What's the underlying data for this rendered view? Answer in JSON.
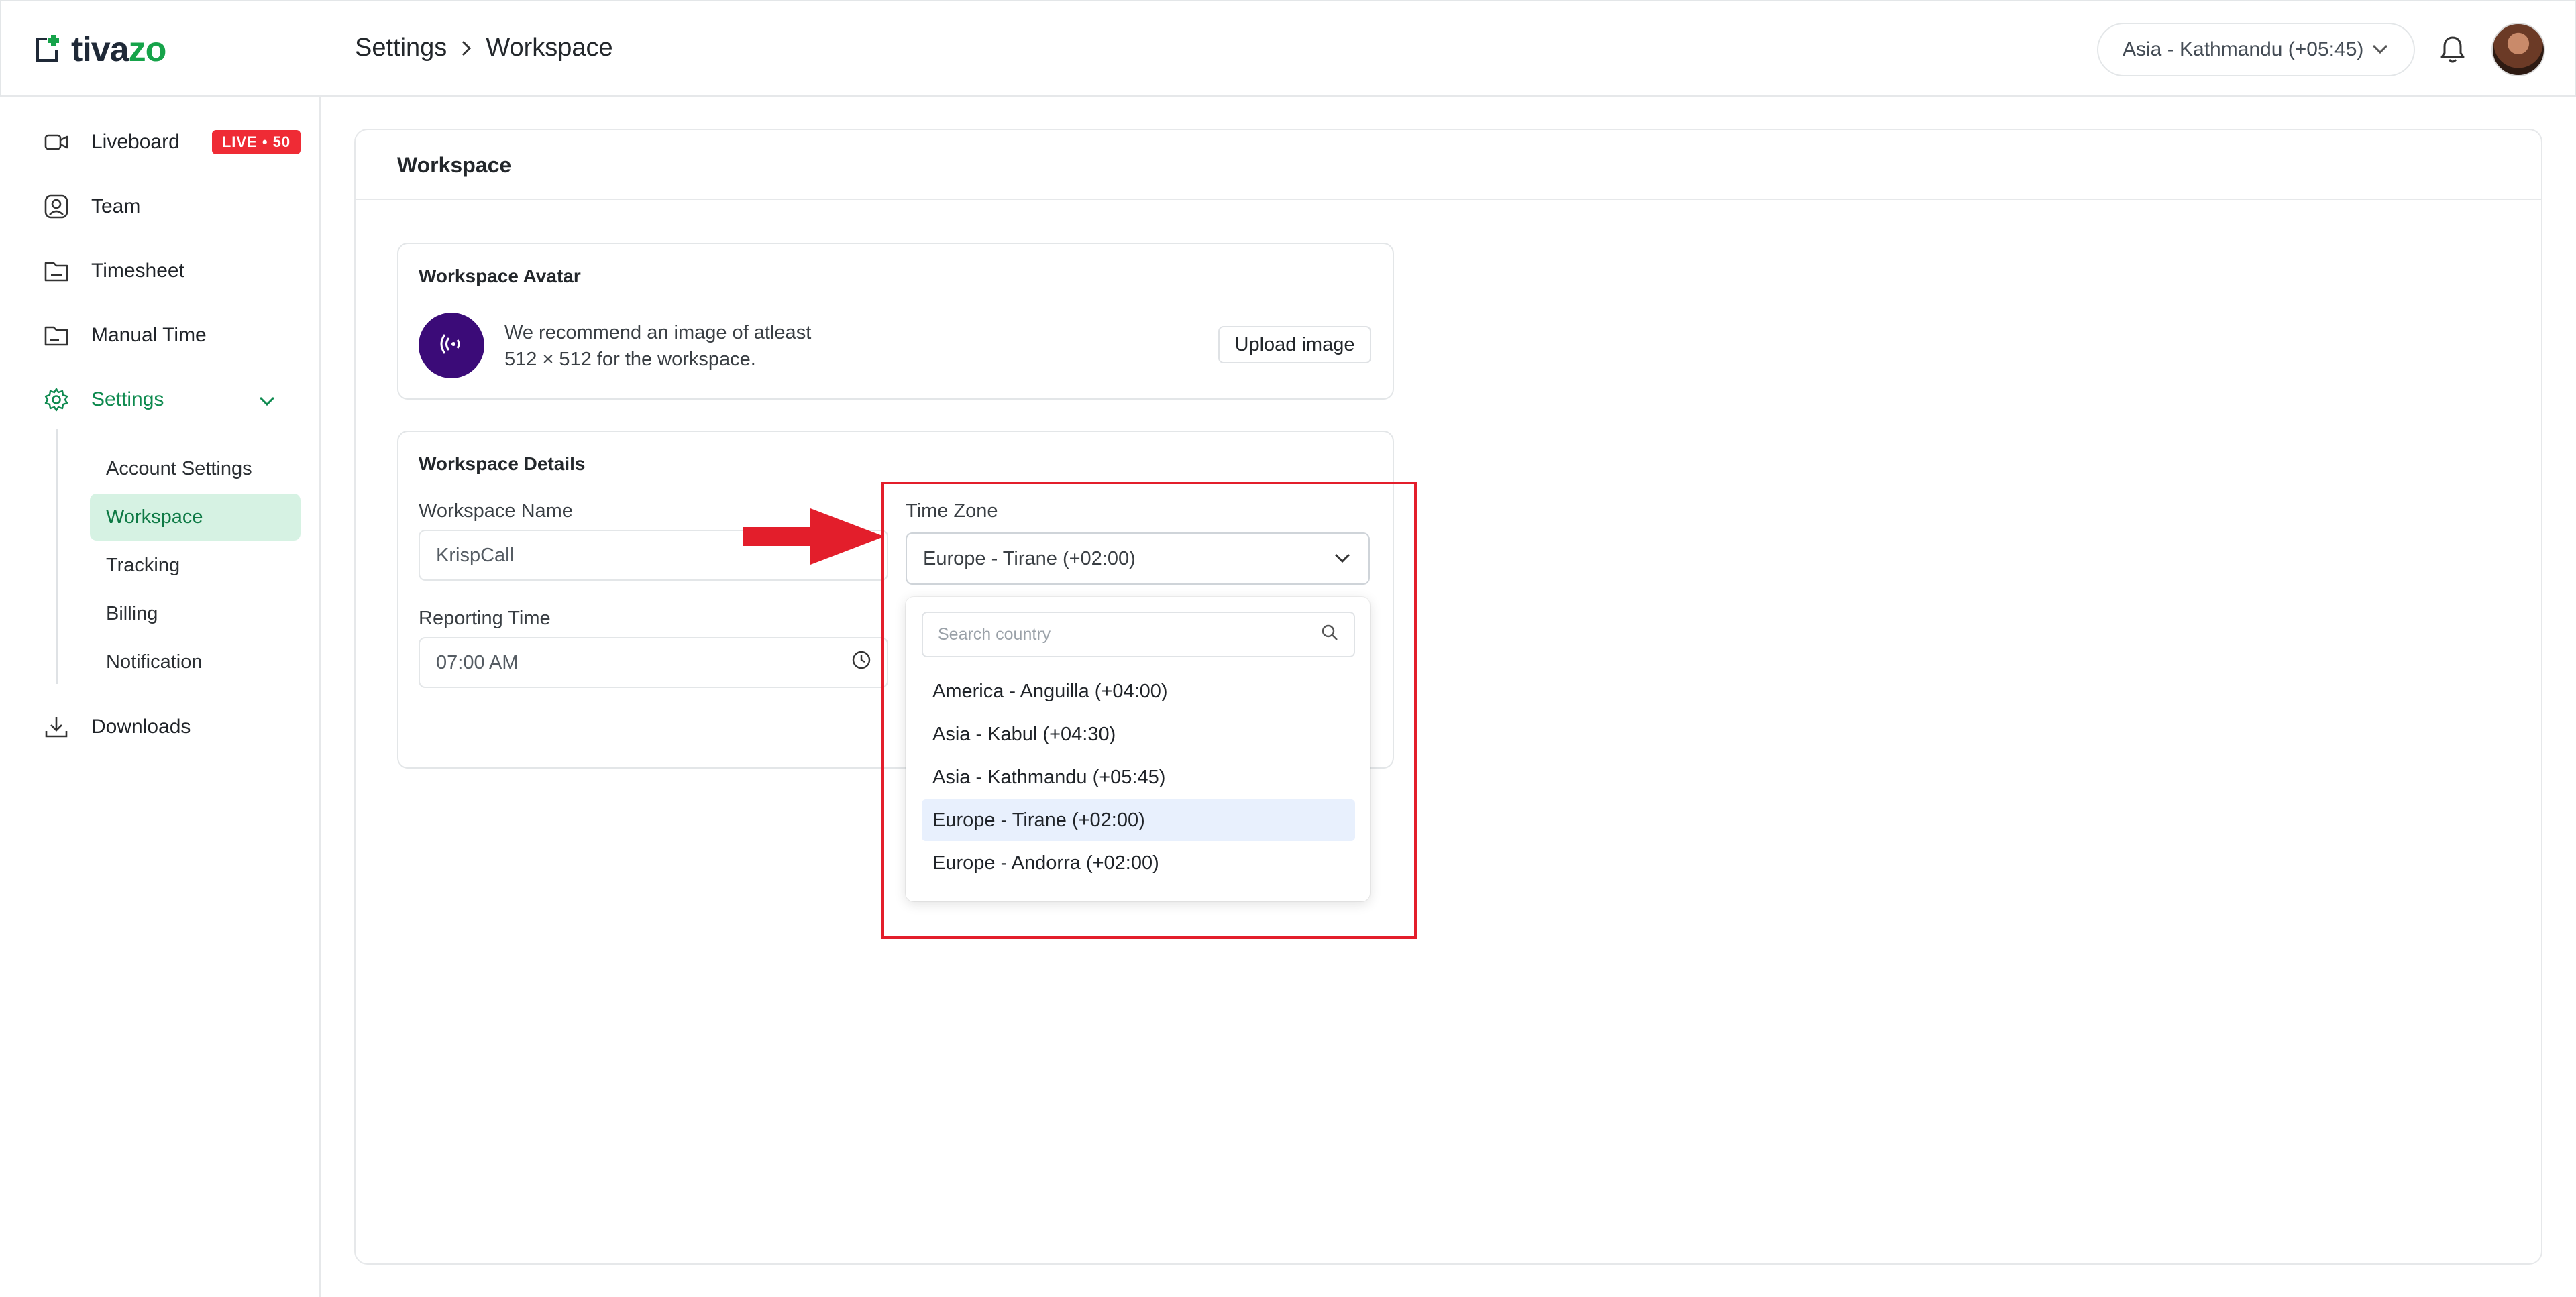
{
  "brand": {
    "name_part1": "tiva",
    "name_part2": "zo"
  },
  "breadcrumb": {
    "parent": "Settings",
    "current": "Workspace"
  },
  "header": {
    "timezone": "Asia - Kathmandu (+05:45)"
  },
  "sidebar": {
    "items": [
      {
        "label": "Liveboard",
        "badge": "LIVE • 50"
      },
      {
        "label": "Team"
      },
      {
        "label": "Timesheet"
      },
      {
        "label": "Manual Time"
      },
      {
        "label": "Settings"
      },
      {
        "label": "Downloads"
      }
    ],
    "settings_sub": [
      {
        "label": "Account Settings"
      },
      {
        "label": "Workspace"
      },
      {
        "label": "Tracking"
      },
      {
        "label": "Billing"
      },
      {
        "label": "Notification"
      }
    ]
  },
  "main": {
    "title": "Workspace",
    "avatar_card": {
      "title": "Workspace Avatar",
      "recommend_line1": "We recommend an image of atleast",
      "recommend_line2": "512 × 512 for the workspace.",
      "upload_label": "Upload image"
    },
    "details_card": {
      "title": "Workspace Details",
      "name_label": "Workspace Name",
      "name_value": "KrispCall",
      "reporting_label": "Reporting Time",
      "reporting_value": "07:00 AM",
      "timezone_label": "Time Zone",
      "timezone_value": "Europe - Tirane (+02:00)"
    },
    "timezone_dropdown": {
      "search_placeholder": "Search country",
      "options": [
        "America - Anguilla (+04:00)",
        "Asia - Kabul (+04:30)",
        "Asia - Kathmandu (+05:45)",
        "Europe - Tirane (+02:00)",
        "Europe - Andorra (+02:00)"
      ],
      "selected": "Europe - Tirane (+02:00)"
    }
  },
  "colors": {
    "accent": "#0e8a4f",
    "active_bg": "#d6f2e3",
    "live_badge": "#ef2b35",
    "annotation": "#e31e2b",
    "selected_option": "#e8f0fd"
  },
  "icons": {
    "logo": "logo-square-icon",
    "breadcrumb_sep": "chevron-right-icon",
    "timezone_chevron": "chevron-down-icon",
    "notifications": "bell-icon",
    "liveboard": "video-camera-icon",
    "team": "user-square-icon",
    "timesheet": "folder-icon",
    "manual_time": "folder-minus-icon",
    "settings": "gear-icon",
    "downloads": "download-icon",
    "reporting_time": "clock-icon",
    "search": "search-icon",
    "workspace_avatar": "signal-icon"
  }
}
